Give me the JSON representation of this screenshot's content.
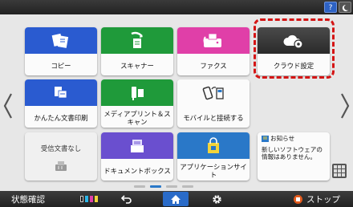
{
  "header": {
    "help_label": "?",
    "sleep_icon": "moon-icon"
  },
  "tiles": [
    {
      "label": "コピー",
      "color": "#2a5bd0",
      "icon": "copy-icon"
    },
    {
      "label": "スキャナー",
      "color": "#1f9a3a",
      "icon": "scanner-icon"
    },
    {
      "label": "ファクス",
      "color": "#e03fa8",
      "icon": "fax-icon"
    },
    {
      "label": "クラウド設定",
      "color": "#3a3a3a",
      "icon": "cloud-gear-icon"
    },
    {
      "label": "かんたん文書印刷",
      "color": "#2a5bd0",
      "icon": "document-print-icon"
    },
    {
      "label": "メディアプリント＆スキャン",
      "color": "#1f9a3a",
      "icon": "usb-sd-icon"
    },
    {
      "label": "モバイルと接続する",
      "color": "#fbfbfb",
      "icon": "mobile-connect-icon"
    },
    {
      "label": "ドキュメントボックス",
      "color": "#6a4fcf",
      "icon": "document-box-icon"
    },
    {
      "label": "アプリケーションサイト",
      "color": "#2a78c8",
      "icon": "shopping-bag-icon"
    }
  ],
  "fax_widget": {
    "label": "受信文書なし"
  },
  "notice": {
    "title": "お知らせ",
    "body": "新しいソフトウェアの情報はありません。"
  },
  "bottombar": {
    "status_label": "状態確認",
    "stop_label": "ストップ"
  },
  "pager": {
    "pages": 4,
    "current": 2
  }
}
